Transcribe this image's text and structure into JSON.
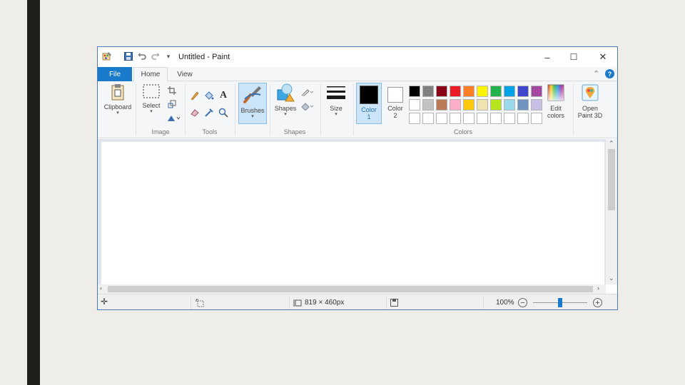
{
  "window": {
    "title": "Untitled - Paint",
    "minimize_icon": "–",
    "maximize_icon": "☐",
    "close_icon": "✕"
  },
  "quick_access": [
    "paint-app-icon",
    "save-icon",
    "undo-icon",
    "redo-icon",
    "customize-qat-icon"
  ],
  "tabs": {
    "file": "File",
    "home": "Home",
    "view": "View"
  },
  "ribbon": {
    "clipboard": {
      "label": "Clipboard"
    },
    "image": {
      "select_label": "Select",
      "group_label": "Image"
    },
    "tools": {
      "group_label": "Tools"
    },
    "brushes": {
      "label": "Brushes"
    },
    "shapes": {
      "label": "Shapes",
      "group_label": "Shapes"
    },
    "size": {
      "label": "Size"
    },
    "colors": {
      "color1_line1": "Color",
      "color1_line2": "1",
      "color2_line1": "Color",
      "color2_line2": "2",
      "group_label": "Colors",
      "edit_line1": "Edit",
      "edit_line2": "colors",
      "color1_value": "#000000",
      "color2_value": "#ffffff",
      "palette_row1": [
        "#000000",
        "#7f7f7f",
        "#880015",
        "#ed1c24",
        "#ff7f27",
        "#fff200",
        "#22b14c",
        "#00a2e8",
        "#3f48cc",
        "#a349a4"
      ],
      "palette_row2": [
        "#ffffff",
        "#c3c3c3",
        "#b97a57",
        "#ffaec9",
        "#ffc90e",
        "#efe4b0",
        "#b5e61d",
        "#99d9ea",
        "#7092be",
        "#c8bfe7"
      ],
      "palette_row3": [
        "#ffffff",
        "#ffffff",
        "#ffffff",
        "#ffffff",
        "#ffffff",
        "#ffffff",
        "#ffffff",
        "#ffffff",
        "#ffffff",
        "#ffffff"
      ]
    },
    "paint3d": {
      "line1": "Open",
      "line2": "Paint 3D"
    }
  },
  "status": {
    "canvas_size": "819 × 460px",
    "zoom": "100%",
    "zoom_level_fraction": 0.5
  }
}
